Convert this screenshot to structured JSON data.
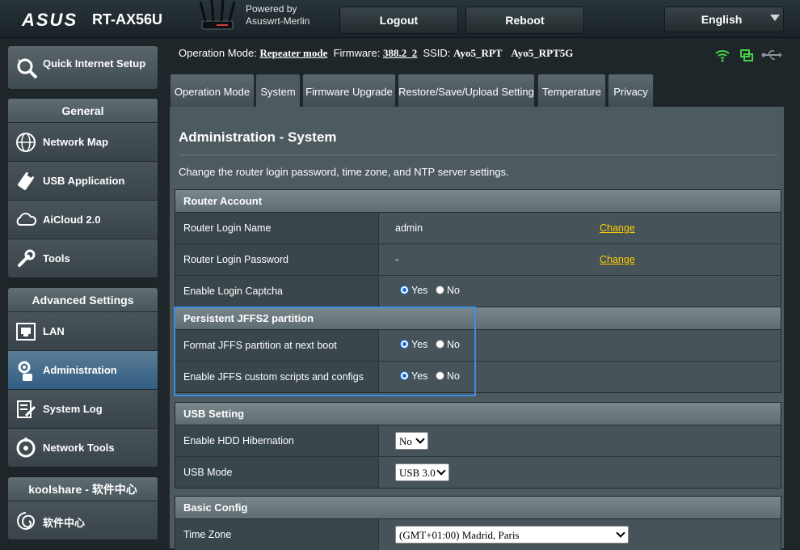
{
  "header": {
    "logo": "ASUS",
    "model": "RT-AX56U",
    "powered_line1": "Powered by",
    "powered_line2": "Asuswrt-Merlin",
    "logout": "Logout",
    "reboot": "Reboot",
    "language": "English"
  },
  "sidebar": {
    "quick_setup": "Quick Internet Setup",
    "general": {
      "title": "General",
      "items": [
        {
          "label": "Network Map",
          "icon": "globe-icon"
        },
        {
          "label": "USB Application",
          "icon": "usb-puzzle-icon"
        },
        {
          "label": "AiCloud 2.0",
          "icon": "cloud-icon"
        },
        {
          "label": "Tools",
          "icon": "wrench-icon"
        }
      ]
    },
    "advanced": {
      "title": "Advanced Settings",
      "items": [
        {
          "label": "LAN",
          "icon": "lan-icon"
        },
        {
          "label": "Administration",
          "icon": "admin-gear-icon"
        },
        {
          "label": "System Log",
          "icon": "log-icon"
        },
        {
          "label": "Network Tools",
          "icon": "network-tools-icon"
        }
      ]
    },
    "koolshare": {
      "title": "koolshare - 软件中心",
      "items": [
        {
          "label": "软件中心",
          "icon": "swirl-icon"
        }
      ]
    }
  },
  "infobar": {
    "mode_label": "Operation Mode:",
    "mode_value": "Repeater mode",
    "fw_label": "Firmware:",
    "fw_value": "388.2_2",
    "ssid_label": "SSID:",
    "ssid1": "Ayo5_RPT",
    "ssid2": "Ayo5_RPT5G"
  },
  "tabs": [
    "Operation Mode",
    "System",
    "Firmware Upgrade",
    "Restore/Save/Upload Setting",
    "Temperature",
    "Privacy"
  ],
  "content": {
    "title": "Administration - System",
    "description": "Change the router login password, time zone, and NTP server settings.",
    "router_account": {
      "header": "Router Account",
      "login_name_label": "Router Login Name",
      "login_name_value": "admin",
      "login_password_label": "Router Login Password",
      "login_password_value": "-",
      "change": "Change",
      "captcha_label": "Enable Login Captcha"
    },
    "jffs": {
      "header": "Persistent JFFS2 partition",
      "format_label": "Format JFFS partition at next boot",
      "scripts_label": "Enable JFFS custom scripts and configs"
    },
    "yes": "Yes",
    "no": "No",
    "usb": {
      "header": "USB Setting",
      "hdd_label": "Enable HDD Hibernation",
      "hdd_value": "No",
      "mode_label": "USB Mode",
      "mode_value": "USB 3.0"
    },
    "basic": {
      "header": "Basic Config",
      "tz_label": "Time Zone",
      "tz_value": "(GMT+01:00) Madrid, Paris"
    }
  }
}
